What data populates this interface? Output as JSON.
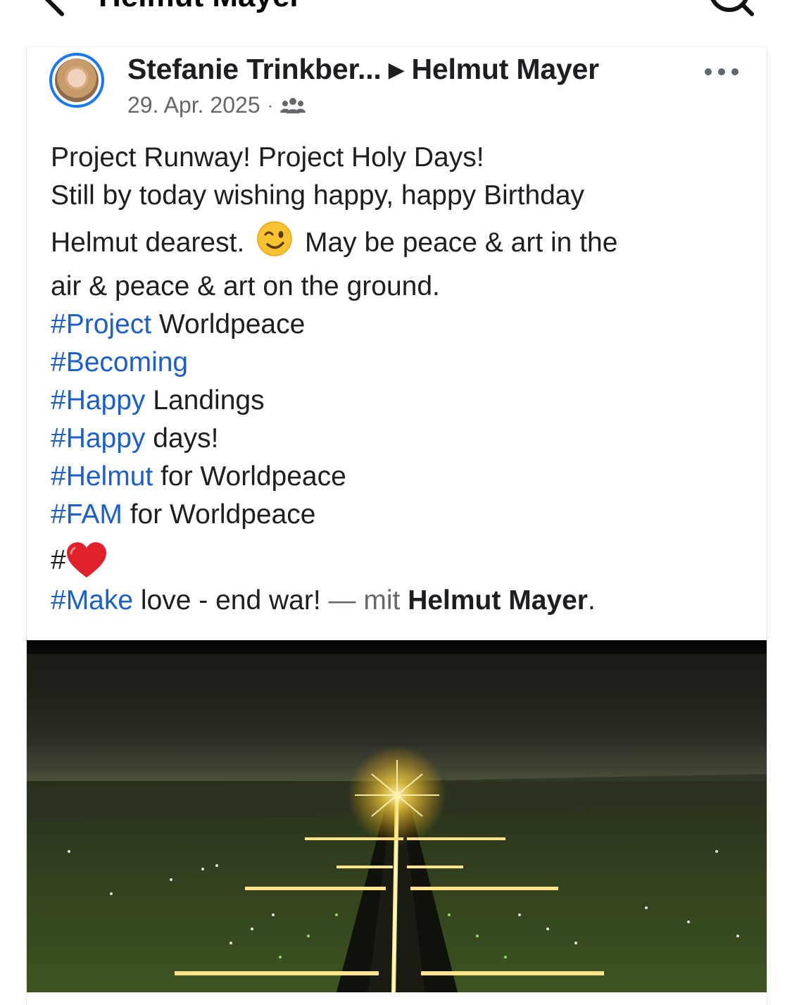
{
  "header": {
    "title": "Helmut Mayer"
  },
  "post": {
    "author": "Stefanie Trinkber...",
    "target": "Helmut Mayer",
    "date": "29. Apr. 2025",
    "audience_icon": "friends-icon",
    "lines": {
      "l1": "Project Runway! Project Holy Days!",
      "l2": "Still by today wishing happy, happy Birthday",
      "l3a": "Helmut dearest.",
      "l3b": "May be peace & art in the",
      "l4": "air & peace & art on the ground.",
      "tag1": "#Project",
      "tag1_rest": " Worldpeace",
      "tag2": "#Becoming",
      "tag3": "#Happy",
      "tag3_rest": " Landings",
      "tag4": "#Happy",
      "tag4_rest": " days!",
      "tag5": "#Helmut",
      "tag5_rest": " for Worldpeace",
      "tag6": "#FAM",
      "tag6_rest": " for Worldpeace",
      "hash_heart": "#",
      "tag7": "#Make",
      "tag7_rest": " love - end war!",
      "with_prefix": " — mit ",
      "with_name": "Helmut Mayer",
      "end": "."
    }
  },
  "icons": [
    "back-arrow-icon",
    "search-icon",
    "more-options-icon",
    "friends-icon",
    "wink-emoji-icon",
    "red-heart-icon"
  ],
  "colors": {
    "hashtag": "#1b5fc7",
    "story_ring": "#1877f2",
    "meta": "#65676b"
  }
}
